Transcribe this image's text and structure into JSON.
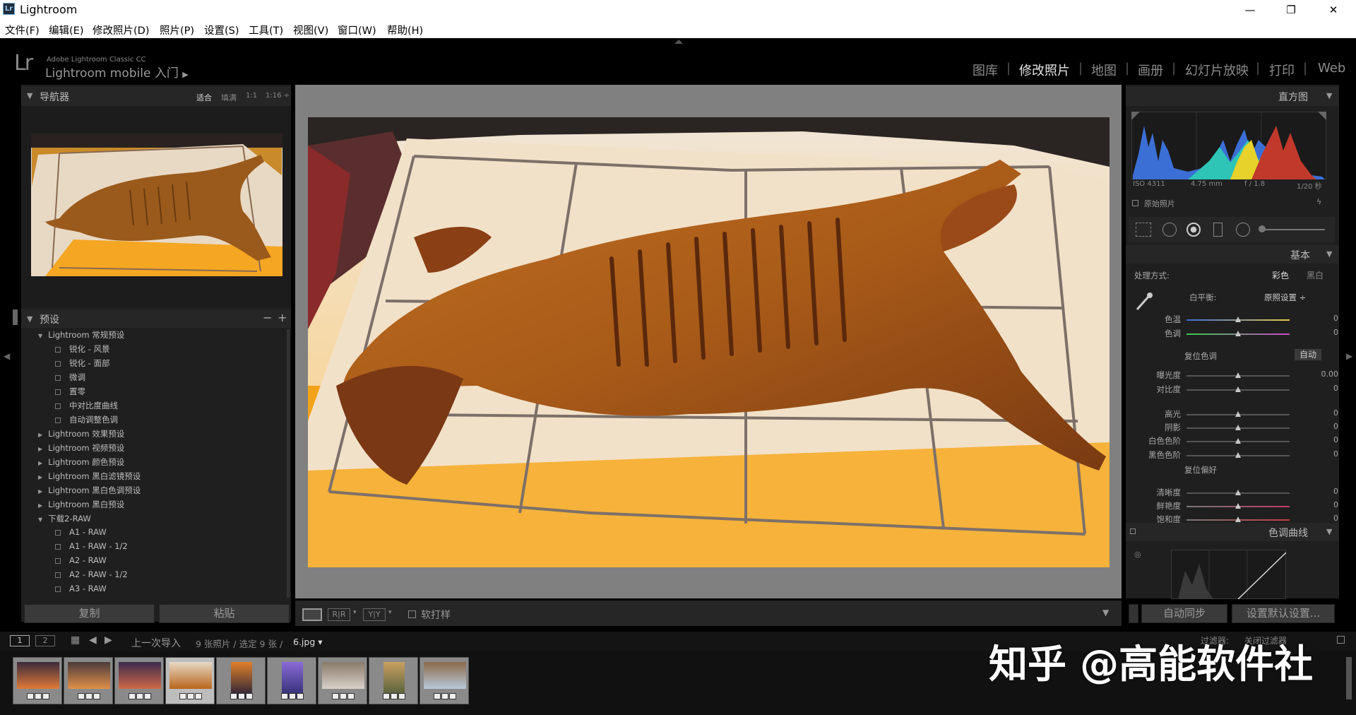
{
  "window": {
    "app_title": "Lightroom",
    "minimize": "—",
    "restore": "❐",
    "close": "✕"
  },
  "menu": [
    "文件(F)",
    "编辑(E)",
    "修改照片(D)",
    "照片(P)",
    "设置(S)",
    "工具(T)",
    "视图(V)",
    "窗口(W)",
    "帮助(H)"
  ],
  "header": {
    "logo": "Lr",
    "product": "Adobe Lightroom Classic CC",
    "mobile": "Lightroom mobile 入门",
    "modules": [
      "图库",
      "修改照片",
      "地图",
      "画册",
      "幻灯片放映",
      "打印",
      "Web"
    ],
    "active_module": "修改照片"
  },
  "navigator": {
    "title": "导航器",
    "zoom_options": [
      "适合",
      "填满",
      "1:1",
      "1:16 ÷"
    ]
  },
  "presets": {
    "title": "预设",
    "items": [
      {
        "label": "Lightroom 常规预设",
        "level": 0,
        "open": true
      },
      {
        "label": "锐化 - 风景",
        "level": 1
      },
      {
        "label": "锐化 - 面部",
        "level": 1
      },
      {
        "label": "微调",
        "level": 1
      },
      {
        "label": "置零",
        "level": 1
      },
      {
        "label": "中对比度曲线",
        "level": 1
      },
      {
        "label": "自动调整色调",
        "level": 1
      },
      {
        "label": "Lightroom 效果预设",
        "level": 0,
        "open": false
      },
      {
        "label": "Lightroom 视频预设",
        "level": 0,
        "open": false
      },
      {
        "label": "Lightroom 颜色预设",
        "level": 0,
        "open": false
      },
      {
        "label": "Lightroom 黑白滤镜预设",
        "level": 0,
        "open": false
      },
      {
        "label": "Lightroom 黑白色调预设",
        "level": 0,
        "open": false
      },
      {
        "label": "Lightroom 黑白预设",
        "level": 0,
        "open": false
      },
      {
        "label": "下载2-RAW",
        "level": 0,
        "open": true
      },
      {
        "label": "A1 - RAW",
        "level": 1
      },
      {
        "label": "A1 - RAW - 1/2",
        "level": 1
      },
      {
        "label": "A2 - RAW",
        "level": 1
      },
      {
        "label": "A2 - RAW - 1/2",
        "level": 1
      },
      {
        "label": "A3 - RAW",
        "level": 1
      }
    ],
    "copy_button": "复制",
    "paste_button": "粘贴"
  },
  "toolbar": {
    "soft_proof": "软打样",
    "compare_1": "R|R",
    "compare_2": "Y|Y"
  },
  "histogram": {
    "title": "直方图",
    "iso": "ISO 4311",
    "focal": "4.75 mm",
    "aperture": "f / 1.8",
    "shutter": "1/20 秒",
    "original": "原始照片"
  },
  "basic": {
    "title": "基本",
    "treatment_label": "处理方式:",
    "color": "彩色",
    "bw": "黑白",
    "wb_label": "白平衡:",
    "wb_value": "原照设置 ÷",
    "tone_label": "复位色调",
    "auto": "自动",
    "presence_label": "复位偏好",
    "sliders": [
      {
        "label": "色温",
        "value": "0",
        "pos": 0.5
      },
      {
        "label": "色调",
        "value": "0",
        "pos": 0.5
      },
      {
        "label": "曝光度",
        "value": "0.00",
        "pos": 0.5
      },
      {
        "label": "对比度",
        "value": "0",
        "pos": 0.5
      },
      {
        "label": "高光",
        "value": "0",
        "pos": 0.5
      },
      {
        "label": "阴影",
        "value": "0",
        "pos": 0.5
      },
      {
        "label": "白色色阶",
        "value": "0",
        "pos": 0.5
      },
      {
        "label": "黑色色阶",
        "value": "0",
        "pos": 0.5
      },
      {
        "label": "清晰度",
        "value": "0",
        "pos": 0.5
      },
      {
        "label": "鲜艳度",
        "value": "0",
        "pos": 0.5
      },
      {
        "label": "饱和度",
        "value": "0",
        "pos": 0.5
      }
    ]
  },
  "tone_curve": {
    "title": "色调曲线"
  },
  "right_buttons": {
    "sync": "自动同步",
    "defaults": "设置默认设置..."
  },
  "filmstrip": {
    "page1": "1",
    "page2": "2",
    "source": "上一次导入",
    "info": "9 张照片 / 选定 9 张 /",
    "file": "6.jpg ▾",
    "filter_label": "过滤器:",
    "filter_value": "关闭过滤器"
  },
  "watermark": "知乎 @高能软件社",
  "colors": {
    "accent_meat": "#b8661c",
    "bg": "#000000",
    "panel": "#2a2a2a"
  }
}
